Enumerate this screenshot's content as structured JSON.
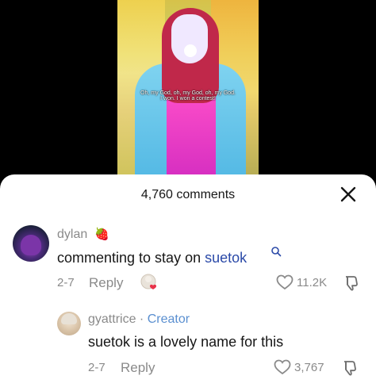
{
  "video": {
    "subtitle_line1": "Oh, my God, oh, my God, oh, my God.",
    "subtitle_line2": "I won. I won a contest!"
  },
  "comments_panel": {
    "title": "4,760 comments",
    "close_icon": "close-icon"
  },
  "comments": [
    {
      "username": "dylan",
      "badge_emoji": "🍓",
      "text_prefix": "commenting to stay on ",
      "text_tag": "suetok",
      "date": "2-7",
      "reply_label": "Reply",
      "likes": "11.2K"
    },
    {
      "username": "gyattrice",
      "separator": " · ",
      "role": "Creator",
      "text": "suetok is a lovely name for this",
      "date": "2-7",
      "reply_label": "Reply",
      "likes": "3,767"
    }
  ],
  "colors": {
    "link": "#2b4aa8",
    "creator": "#5a8fd0",
    "muted": "#8a8a8a"
  }
}
